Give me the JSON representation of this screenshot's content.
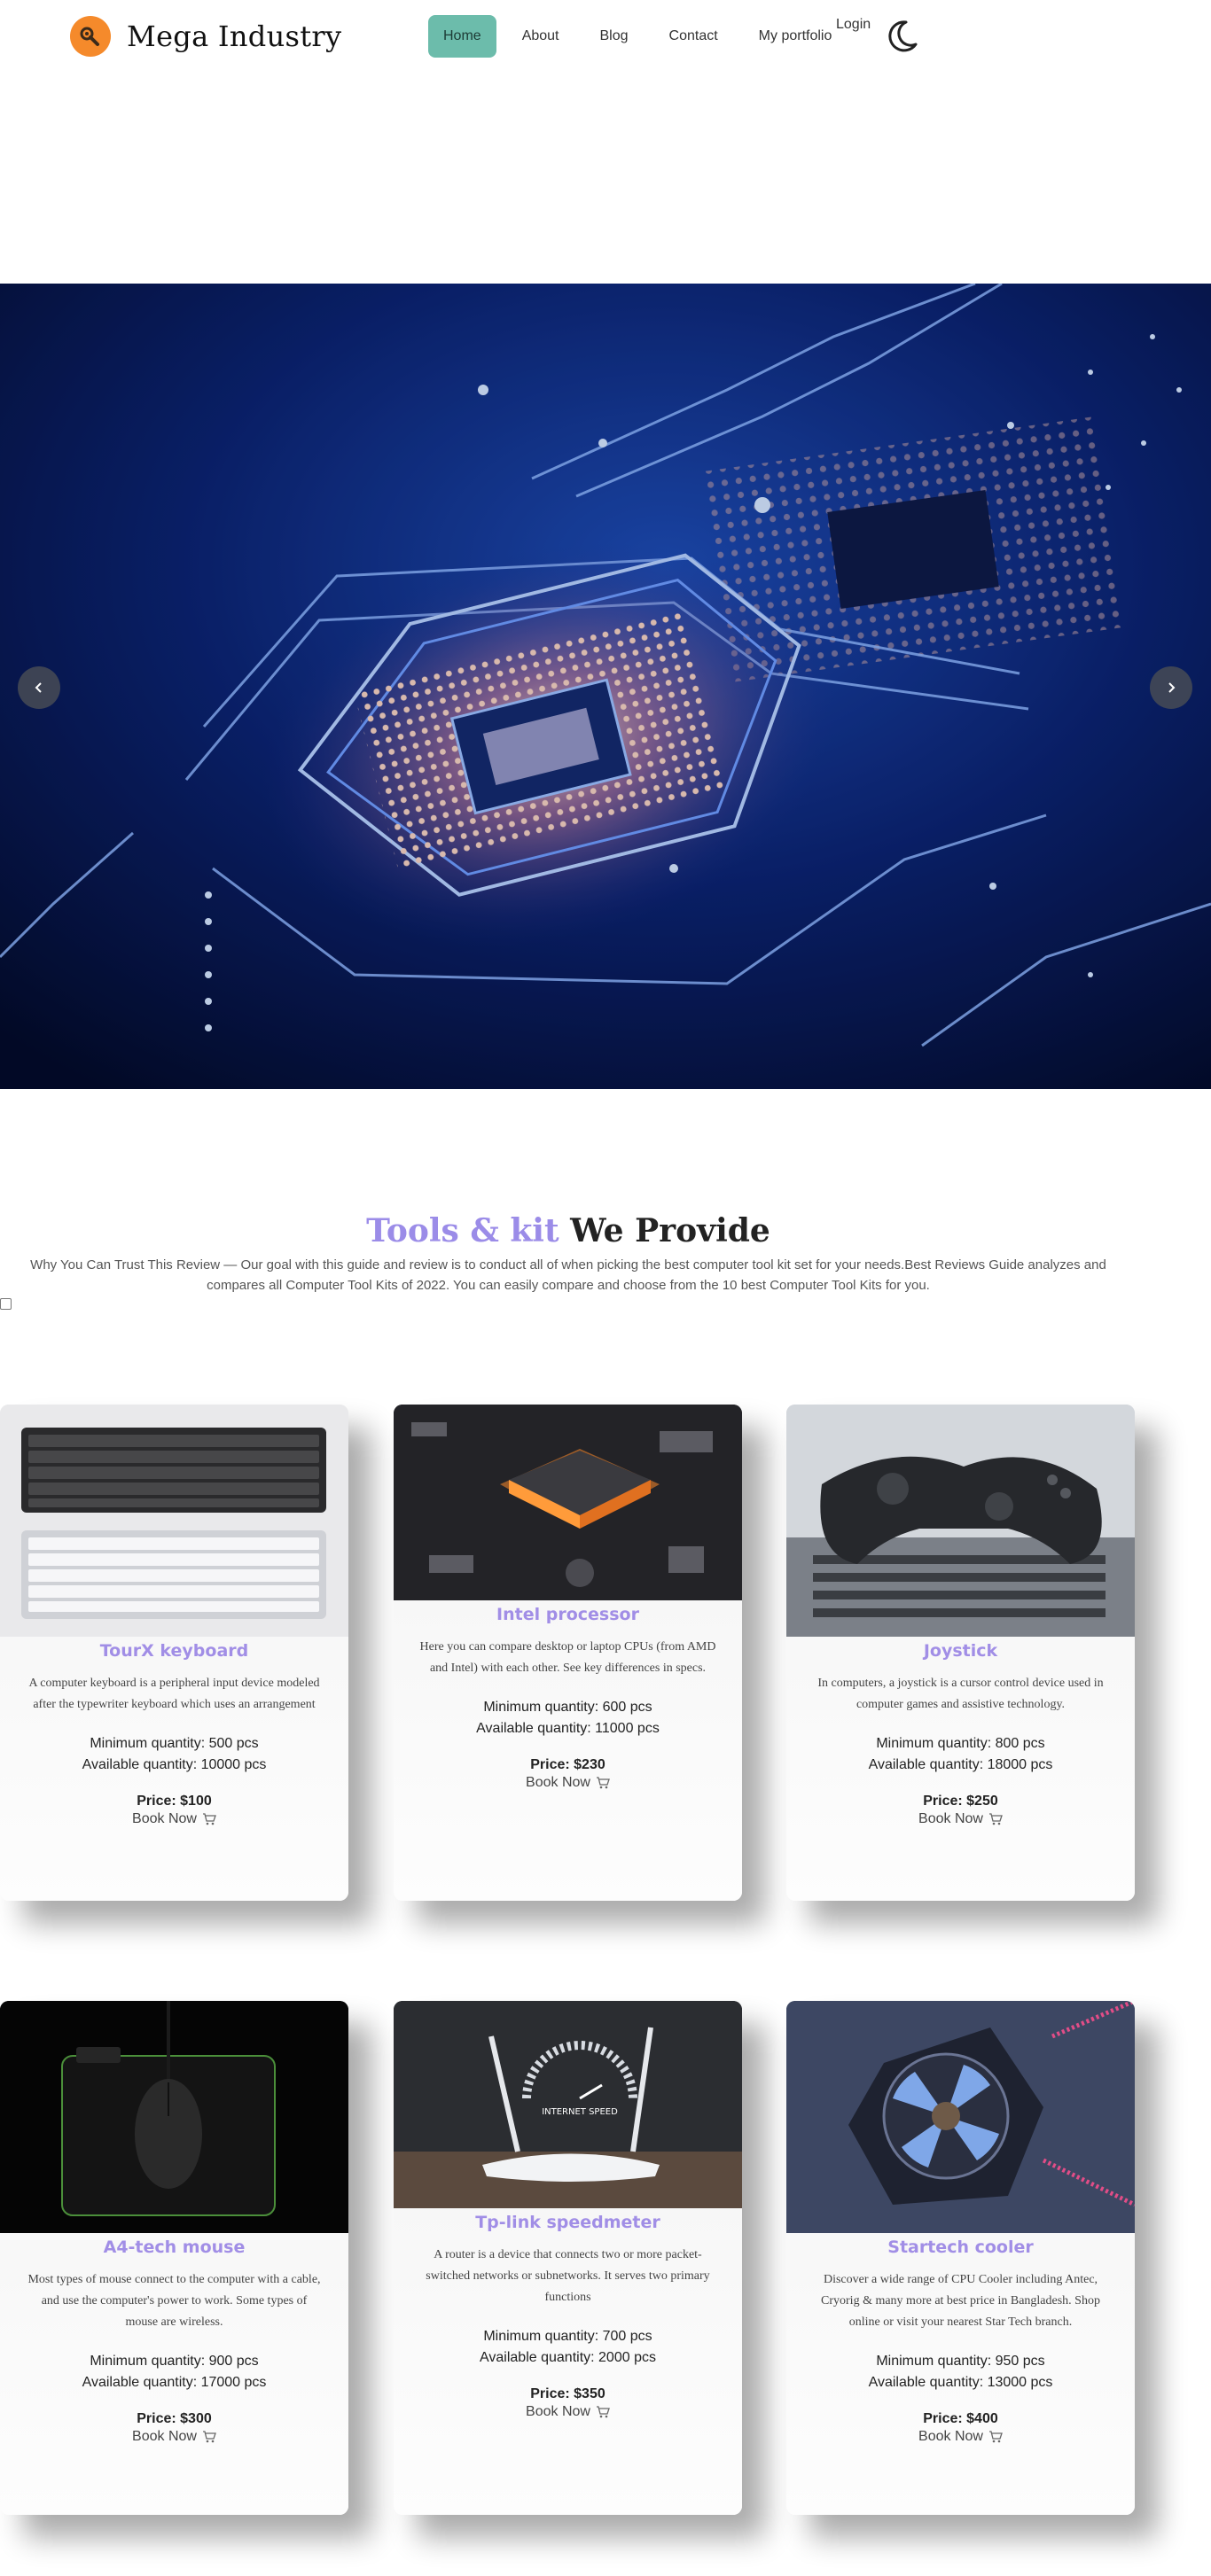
{
  "nav": {
    "brand": "Mega Industry",
    "menu": [
      {
        "label": "Home",
        "active": true
      },
      {
        "label": "About",
        "active": false
      },
      {
        "label": "Blog",
        "active": false
      },
      {
        "label": "Contact",
        "active": false
      },
      {
        "label": "My portfolio",
        "active": false
      }
    ],
    "login": "Login",
    "logo_icon": "wrench-icon",
    "theme_icon": "moon-icon"
  },
  "hero": {
    "image": "circuit-board-processor-image",
    "prev_icon": "chevron-left-icon",
    "next_icon": "chevron-right-icon"
  },
  "section": {
    "title_accent": "Tools & kit",
    "title_rest": "We Provide",
    "description": "Why You Can Trust This Review — Our goal with this guide and review is to conduct all of when picking the best computer tool kit set for your needs.Best Reviews Guide analyzes and compares all Computer Tool Kits of 2022. You can easily compare and choose from the 10 best Computer Tool Kits for you."
  },
  "products": [
    {
      "name": "TourX keyboard",
      "description": "A computer keyboard is a peripheral input device modeled after the typewriter keyboard which uses an arrangement",
      "min_qty": "Minimum quantity: 500 pcs",
      "avail_qty": "Available quantity: 10000 pcs",
      "price": "Price: $100",
      "book": "Book Now"
    },
    {
      "name": "Intel processor",
      "description": "Here you can compare desktop or laptop CPUs (from AMD and Intel) with each other. See key differences in specs.",
      "min_qty": "Minimum quantity: 600 pcs",
      "avail_qty": "Available quantity: 11000 pcs",
      "price": "Price: $230",
      "book": "Book Now"
    },
    {
      "name": "Joystick",
      "description": "In computers, a joystick is a cursor control device used in computer games and assistive technology.",
      "min_qty": "Minimum quantity: 800 pcs",
      "avail_qty": "Available quantity: 18000 pcs",
      "price": "Price: $250",
      "book": "Book Now"
    },
    {
      "name": "A4-tech mouse",
      "description": "Most types of mouse connect to the computer with a cable, and use the computer's power to work. Some types of mouse are wireless.",
      "min_qty": "Minimum quantity: 900 pcs",
      "avail_qty": "Available quantity: 17000 pcs",
      "price": "Price: $300",
      "book": "Book Now"
    },
    {
      "name": "Tp-link speedmeter",
      "description": "A router is a device that connects two or more packet-switched networks or subnetworks. It serves two primary functions",
      "min_qty": "Minimum quantity: 700 pcs",
      "avail_qty": "Available quantity: 2000 pcs",
      "price": "Price: $350",
      "book": "Book Now"
    },
    {
      "name": "Startech cooler",
      "description": "Discover a wide range of CPU Cooler including Antec, Cryorig & many more at best price in Bangladesh. Shop online or visit your nearest Star Tech branch.",
      "min_qty": "Minimum quantity: 950 pcs",
      "avail_qty": "Available quantity: 13000 pcs",
      "price": "Price: $400",
      "book": "Book Now"
    }
  ],
  "router_image_text": "INTERNET SPEED"
}
